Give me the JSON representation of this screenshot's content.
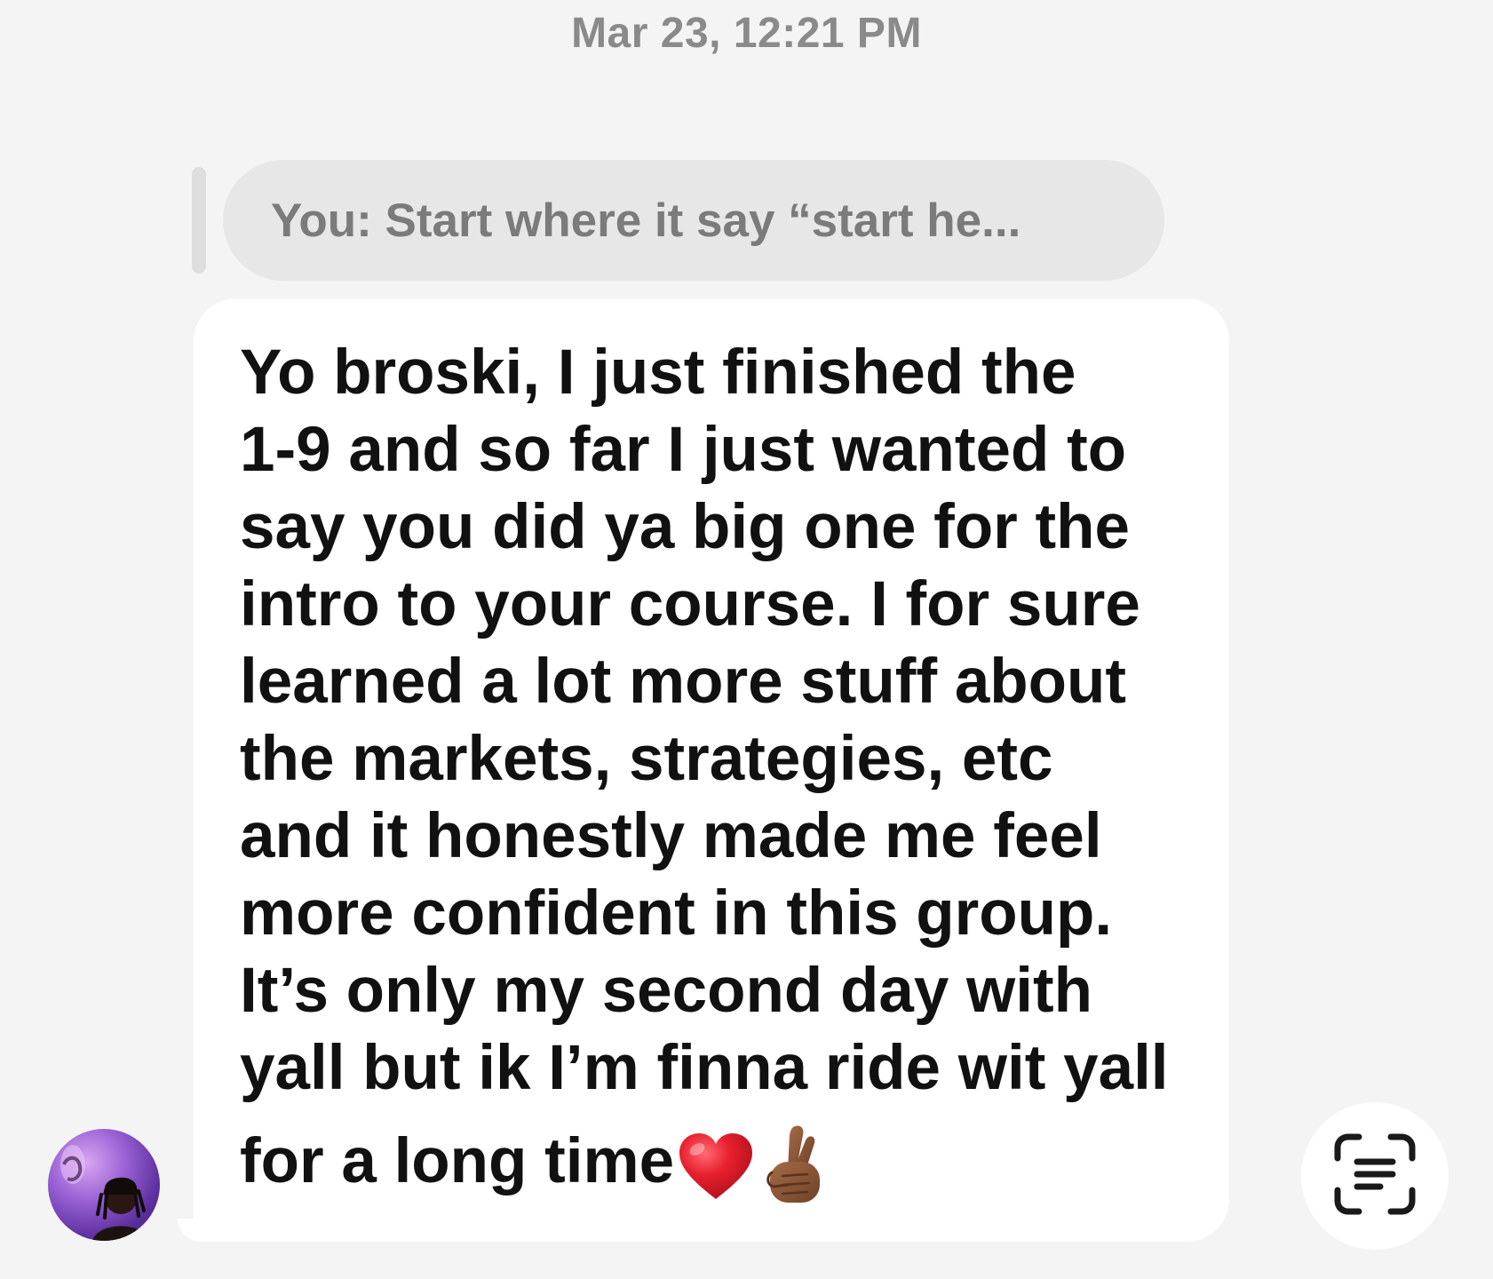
{
  "conversation": {
    "timestamp": "Mar 23, 12:21 PM",
    "reply_preview": "You: Start where it say “start he...",
    "message": {
      "lines": [
        "Yo broski, I just finished the",
        "1-9 and so far I just wanted to",
        "say you did ya big one for the",
        "intro to your course. I for sure",
        "learned a lot more stuff about",
        "the markets, strategies, etc",
        "and it honestly made me feel",
        "more confident in this group.",
        "It’s only my second day with",
        "yall but ik I’m finna ride wit yall",
        "for a long time"
      ],
      "trailing_emojis": [
        "red-heart",
        "crossed-fingers-medium-dark-skin"
      ]
    },
    "sender_avatar": "avatar",
    "action_button_icon": "text-scan-icon"
  },
  "colors": {
    "background": "#f4f4f4",
    "bubble": "#ffffff",
    "reply_bubble": "#e7e7e7",
    "timestamp_text": "#8a8a8a",
    "heart": "#e0202e",
    "skin_tone": "#8d5a3b"
  }
}
